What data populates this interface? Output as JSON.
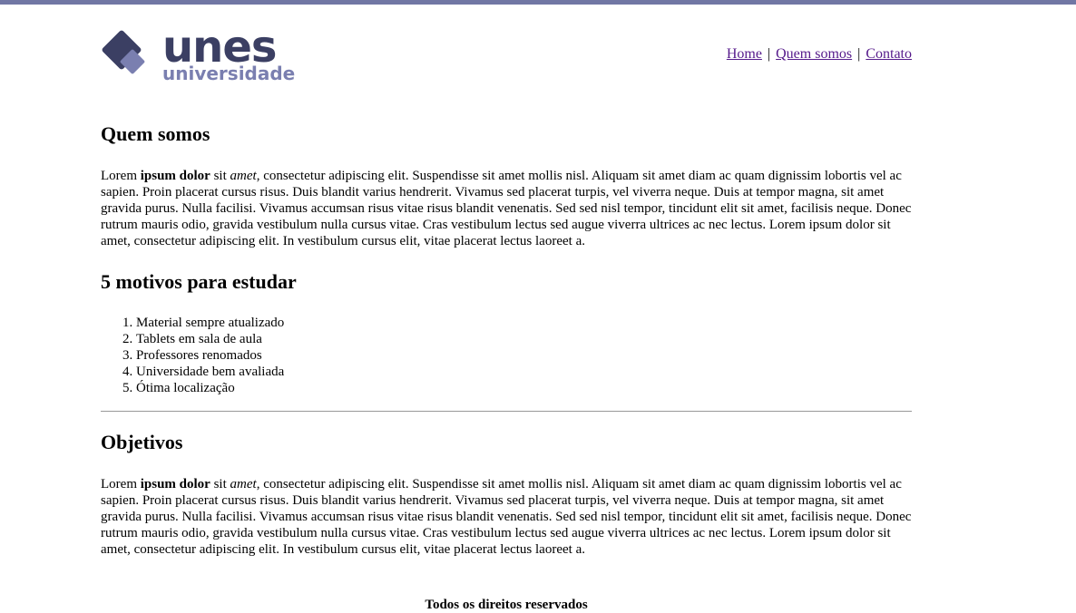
{
  "header": {
    "logo": {
      "word": "unes",
      "subword": "universidade"
    },
    "nav": [
      {
        "label": "Home"
      },
      {
        "label": "Quem somos"
      },
      {
        "label": "Contato"
      }
    ],
    "nav_separator": "|"
  },
  "sections": {
    "quem_somos": {
      "title": "Quem somos",
      "text_lead": "Lorem ",
      "text_bold": "ipsum dolor",
      "text_mid": " sit ",
      "text_italic": "amet",
      "text_rest": ", consectetur adipiscing elit. Suspendisse sit amet mollis nisl. Aliquam sit amet diam ac quam dignissim lobortis vel ac sapien. Proin placerat cursus risus. Duis blandit varius hendrerit. Vivamus sed placerat turpis, vel viverra neque. Duis at tempor magna, sit amet gravida purus. Nulla facilisi. Vivamus accumsan risus vitae risus blandit venenatis. Sed sed nisl tempor, tincidunt elit sit amet, facilisis neque. Donec rutrum mauris odio, gravida vestibulum nulla cursus vitae. Cras vestibulum lectus sed augue viverra ultrices ac nec lectus. Lorem ipsum dolor sit amet, consectetur adipiscing elit. In vestibulum cursus elit, vitae placerat lectus laoreet a."
    },
    "motivos": {
      "title": "5 motivos para estudar",
      "items": [
        "Material sempre atualizado",
        "Tablets em sala de aula",
        "Professores renomados",
        "Universidade bem avaliada",
        "Ótima localização"
      ]
    },
    "objetivos": {
      "title": "Objetivos",
      "text_lead": "Lorem ",
      "text_bold": "ipsum dolor",
      "text_mid": " sit ",
      "text_italic": "amet",
      "text_rest": ", consectetur adipiscing elit. Suspendisse sit amet mollis nisl. Aliquam sit amet diam ac quam dignissim lobortis vel ac sapien. Proin placerat cursus risus. Duis blandit varius hendrerit. Vivamus sed placerat turpis, vel viverra neque. Duis at tempor magna, sit amet gravida purus. Nulla facilisi. Vivamus accumsan risus vitae risus blandit venenatis. Sed sed nisl tempor, tincidunt elit sit amet, facilisis neque. Donec rutrum mauris odio, gravida vestibulum nulla cursus vitae. Cras vestibulum lectus sed augue viverra ultrices ac nec lectus. Lorem ipsum dolor sit amet, consectetur adipiscing elit. In vestibulum cursus elit, vitae placerat lectus laoreet a."
    }
  },
  "footer": {
    "text": "Todos os direitos reservados"
  },
  "colors": {
    "top_bar": "#7177a4",
    "logo_dark": "#3b3f63",
    "logo_light": "#7a7fb0",
    "link": "#551a8b"
  }
}
